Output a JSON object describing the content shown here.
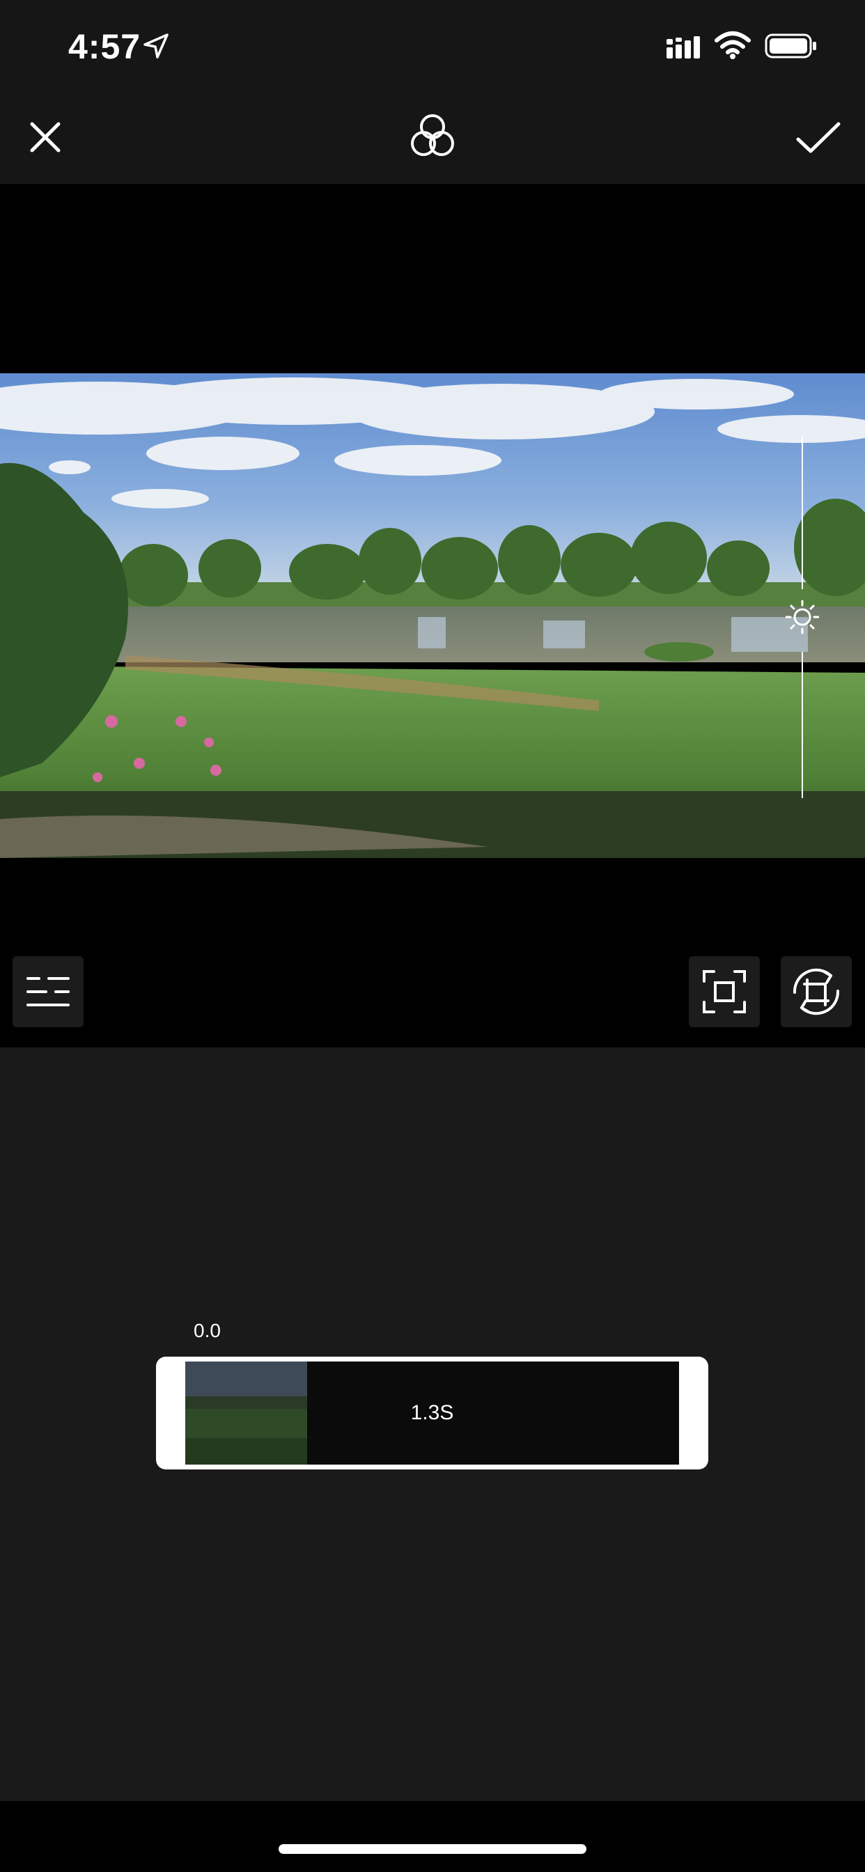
{
  "status_bar": {
    "time": "4:57",
    "icons": [
      "location-arrow-icon",
      "cellular-signal-icon",
      "wifi-icon",
      "battery-icon"
    ]
  },
  "toolbar": {
    "icons": [
      "close-icon",
      "filters-icon",
      "checkmark-icon"
    ]
  },
  "preview": {
    "icons": [
      "brightness-icon"
    ]
  },
  "tools": {
    "icons": [
      "adjust-icon",
      "crop-icon",
      "rotate-crop-icon"
    ]
  },
  "timeline": {
    "start_time": "0.0",
    "clip_duration": "1.3S"
  },
  "colors": {
    "background": "#000000",
    "toolbar": "#161616",
    "panel": "#1a1a1a",
    "tool_button": "#1c1c1c",
    "accent": "#ffffff"
  }
}
